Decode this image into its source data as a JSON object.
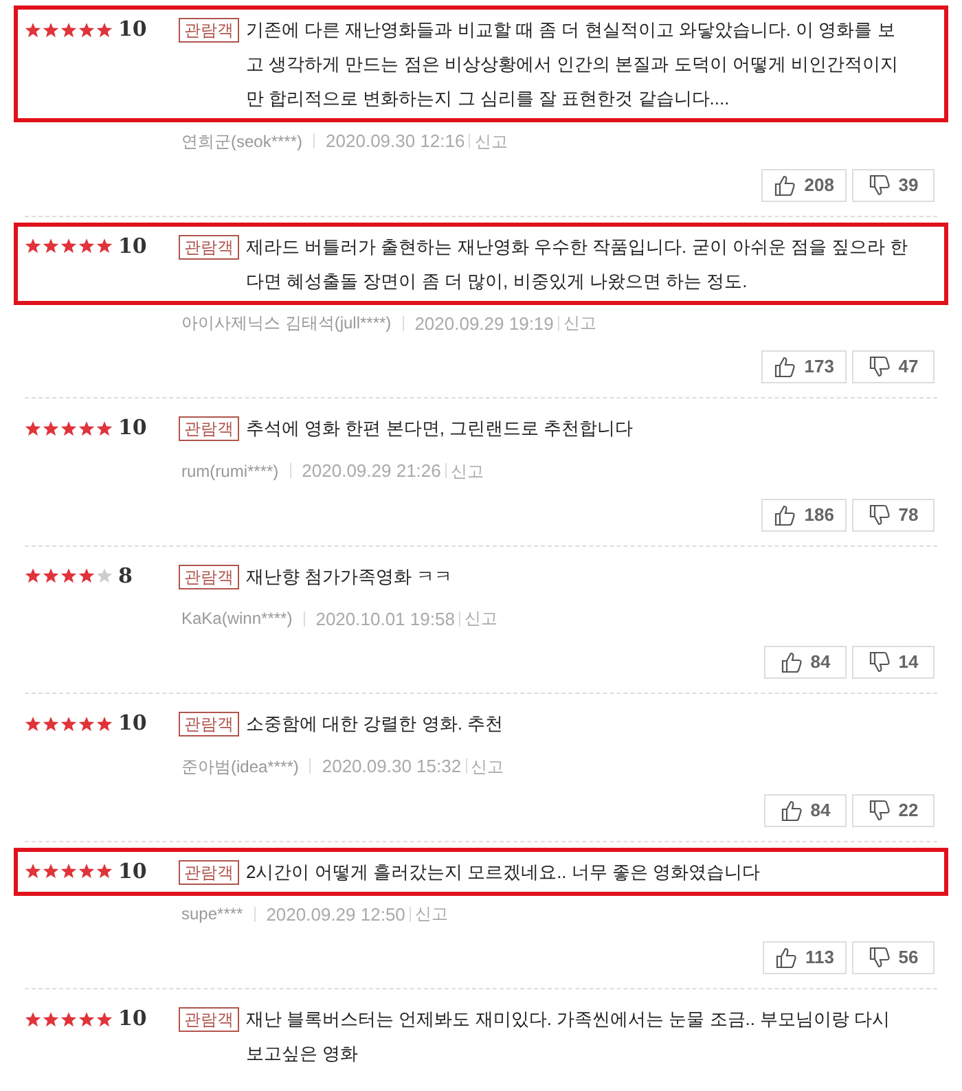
{
  "reviews": [
    {
      "stars": 5,
      "score": "10",
      "badge": "관람객",
      "text": "기존에 다른 재난영화들과 비교할 때 좀 더 현실적이고 와닿았습니다. 이 영화를 보고 생각하게 만드는 점은 비상상황에서 인간의 본질과 도덕이 어떻게 비인간적이지만 합리적으로 변화하는지 그 심리를 잘 표현한것 같습니다....",
      "author": "연희군(seok****)",
      "date": "2020.09.30 12:16",
      "report": "신고",
      "likes": "208",
      "dislikes": "39",
      "highlighted": true
    },
    {
      "stars": 5,
      "score": "10",
      "badge": "관람객",
      "text": "제라드 버틀러가 출현하는 재난영화 우수한 작품입니다. 굳이 아쉬운 점을 짚으라 한다면 혜성출돌 장면이 좀 더 많이, 비중있게 나왔으면 하는 정도.",
      "author": "아이사제닉스 김태석(jull****)",
      "date": "2020.09.29 19:19",
      "report": "신고",
      "likes": "173",
      "dislikes": "47",
      "highlighted": true
    },
    {
      "stars": 5,
      "score": "10",
      "badge": "관람객",
      "text": "추석에 영화 한편 본다면, 그린랜드로 추천합니다",
      "author": "rum(rumi****)",
      "date": "2020.09.29 21:26",
      "report": "신고",
      "likes": "186",
      "dislikes": "78",
      "highlighted": false
    },
    {
      "stars": 4,
      "score": "8",
      "badge": "관람객",
      "text": "재난향 첨가가족영화 ㅋㅋ",
      "author": "KaKa(winn****)",
      "date": "2020.10.01 19:58",
      "report": "신고",
      "likes": "84",
      "dislikes": "14",
      "highlighted": false
    },
    {
      "stars": 5,
      "score": "10",
      "badge": "관람객",
      "text": "소중함에 대한 강렬한 영화. 추천",
      "author": "준아범(idea****)",
      "date": "2020.09.30 15:32",
      "report": "신고",
      "likes": "84",
      "dislikes": "22",
      "highlighted": false
    },
    {
      "stars": 5,
      "score": "10",
      "badge": "관람객",
      "text": "2시간이 어떻게 흘러갔는지 모르겠네요.. 너무 좋은 영화였습니다",
      "author": "supe****",
      "date": "2020.09.29 12:50",
      "report": "신고",
      "likes": "113",
      "dislikes": "56",
      "highlighted": true
    },
    {
      "stars": 5,
      "score": "10",
      "badge": "관람객",
      "text": "재난 블록버스터는 언제봐도 재미있다. 가족씬에서는 눈물 조금.. 부모님이랑 다시 보고싶은 영화",
      "highlighted": false
    }
  ]
}
